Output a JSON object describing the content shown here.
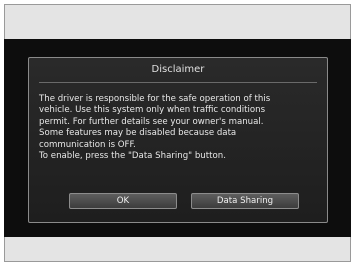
{
  "dialog": {
    "title": "Disclaimer",
    "message": "The driver is responsible for the safe operation of this\nvehicle. Use this system only when traffic conditions\npermit. For further details see your owner's manual.\nSome features may be disabled because data\ncommunication is OFF.\nTo enable, press the \"Data Sharing\" button.",
    "buttons": {
      "ok_label": "OK",
      "data_sharing_label": "Data Sharing"
    }
  },
  "colors": {
    "screen_background": "#0d0d0d",
    "dialog_background": "#232323",
    "text": "#e8e8e8",
    "button_background": "#4a4a4a"
  }
}
